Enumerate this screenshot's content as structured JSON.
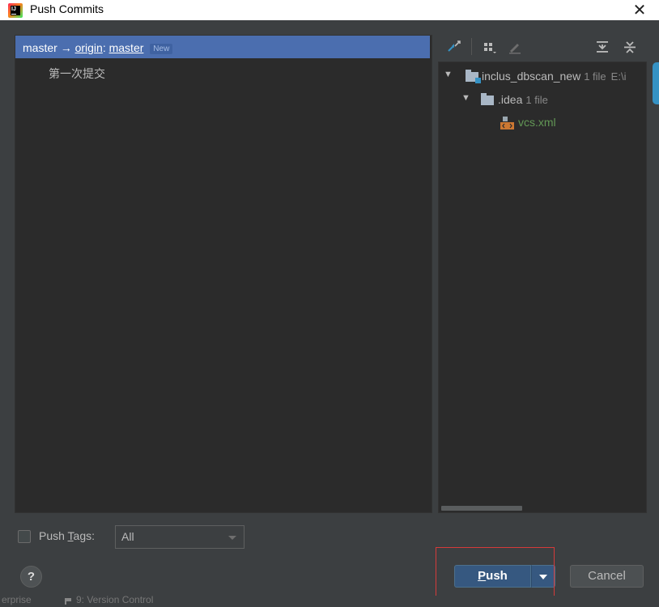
{
  "window": {
    "title": "Push Commits",
    "close_glyph": "✕"
  },
  "commits": {
    "branch": {
      "local": "master",
      "arrow": "→",
      "remote": "origin",
      "separator": ":",
      "remote_branch": "master",
      "badge": "New"
    },
    "messages": [
      "第一次提交"
    ]
  },
  "toolbar": {
    "icons": [
      "expand-collapse-icon",
      "group-by-icon",
      "edit-source-icon",
      "expand-all-icon",
      "collapse-all-icon"
    ]
  },
  "files": {
    "root": {
      "name": "inclus_dbscan_new",
      "count": "1 file",
      "path": "E:\\i"
    },
    "folder": {
      "name": ".idea",
      "count": "1 file"
    },
    "file": {
      "name": "vcs.xml"
    }
  },
  "push_tags": {
    "label_prefix": "Push ",
    "label_mnemonic": "T",
    "label_suffix": "ags:",
    "value": "All"
  },
  "help": {
    "label": "?"
  },
  "buttons": {
    "push_mnemonic": "P",
    "push_rest": "ush",
    "cancel": "Cancel"
  },
  "status_strip": {
    "left": "erprise",
    "right": "9: Version Control"
  },
  "colors": {
    "selection": "#4b6eaf",
    "panel_bg": "#2b2b2b",
    "dialog_bg": "#3c3f41",
    "push_button": "#365880",
    "xml_file": "#629755",
    "highlight_box": "#d53a3a"
  }
}
